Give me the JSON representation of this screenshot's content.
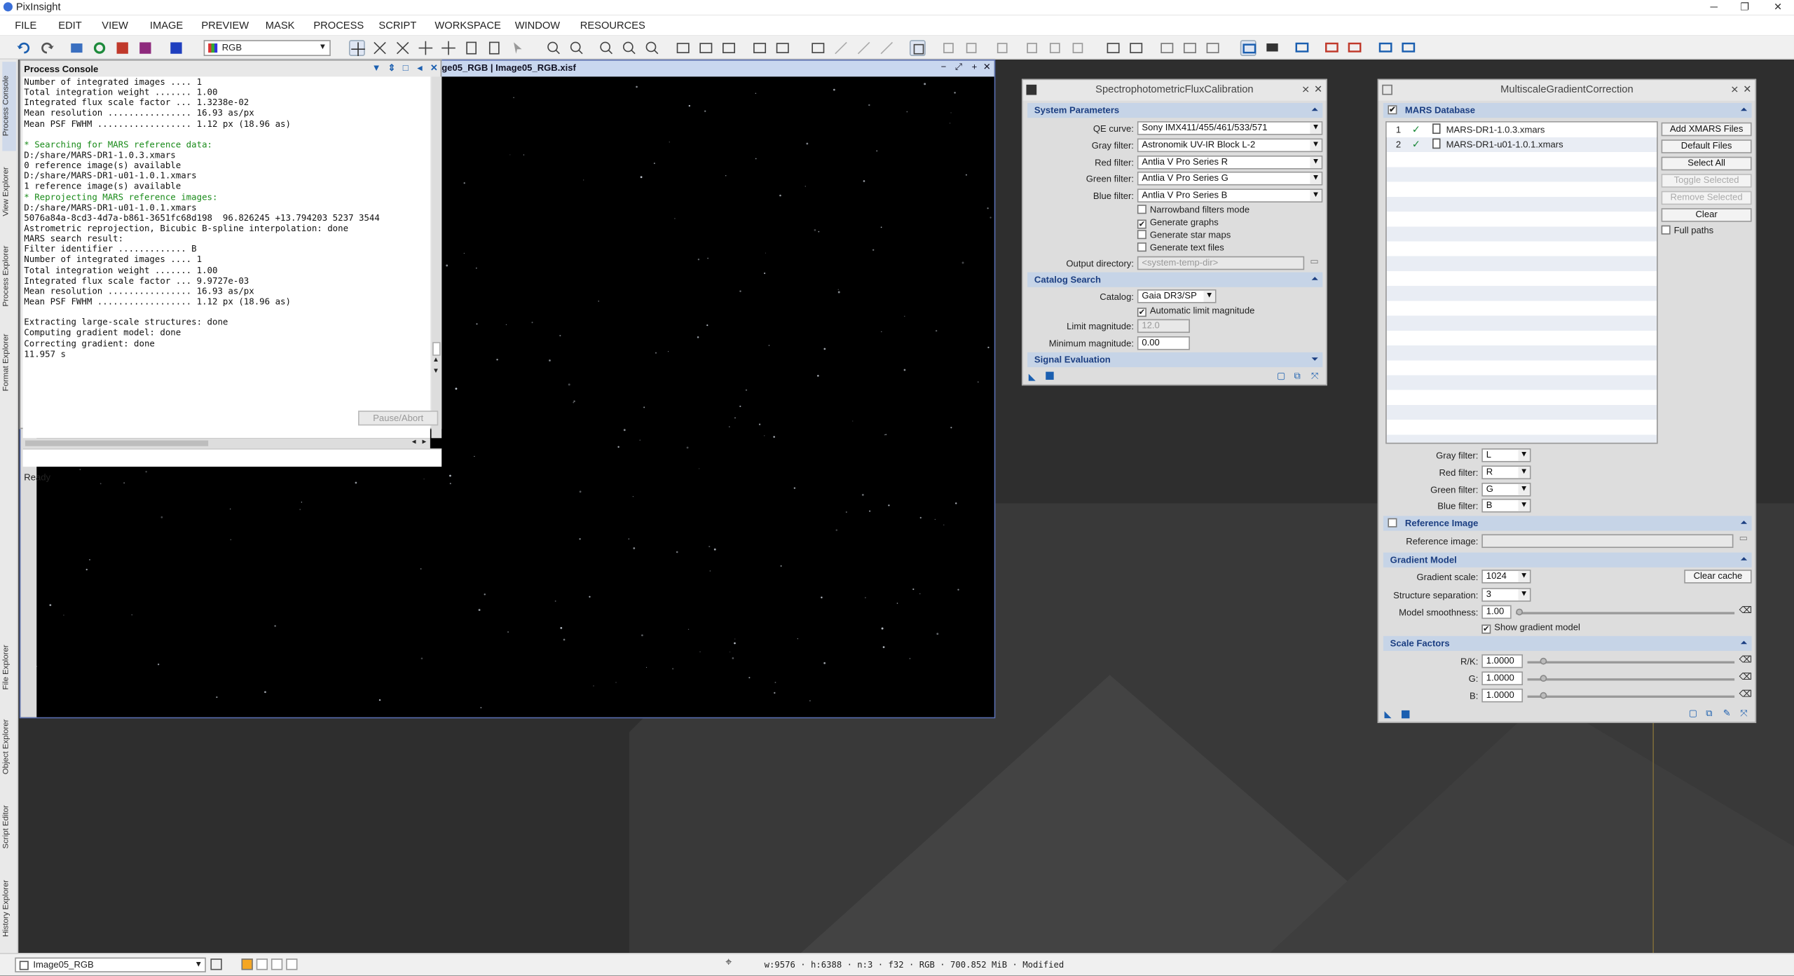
{
  "app": {
    "title": "PixInsight"
  },
  "menu": [
    "FILE",
    "EDIT",
    "VIEW",
    "IMAGE",
    "PREVIEW",
    "MASK",
    "PROCESS",
    "SCRIPT",
    "WORKSPACE",
    "WINDOW",
    "RESOURCES"
  ],
  "toolbar": {
    "view_selector": "RGB"
  },
  "left_dock": [
    "Process Console",
    "View Explorer",
    "Process Explorer",
    "Format Explorer",
    "File Explorer",
    "Object Explorer",
    "Script Editor",
    "History Explorer"
  ],
  "image_window": {
    "title": "ge05_RGB | Image05_RGB.xisf"
  },
  "console": {
    "title": "Process Console",
    "lines": [
      "Number of integrated images .... 1",
      "Total integration weight ....... 1.00",
      "Integrated flux scale factor ... 1.3238e-02",
      "Mean resolution ................ 16.93 as/px",
      "Mean PSF FWHM .................. 1.12 px (18.96 as)",
      "",
      "* Searching for MARS reference data:",
      "D:/share/MARS-DR1-1.0.3.xmars",
      "0 reference image(s) available",
      "D:/share/MARS-DR1-u01-1.0.1.xmars",
      "1 reference image(s) available",
      "* Reprojecting MARS reference images:",
      "D:/share/MARS-DR1-u01-1.0.1.xmars",
      "5076a84a-8cd3-4d7a-b861-3651fc68d198  96.826245 +13.794203 5237 3544",
      "Astrometric reprojection, Bicubic B-spline interpolation: done",
      "MARS search result:",
      "Filter identifier ............. B",
      "Number of integrated images .... 1",
      "Total integration weight ....... 1.00",
      "Integrated flux scale factor ... 9.9727e-03",
      "Mean resolution ................ 16.93 as/px",
      "Mean PSF FWHM .................. 1.12 px (18.96 as)",
      "",
      "Extracting large-scale structures: done",
      "Computing gradient model: done",
      "Correcting gradient: done",
      "11.957 s"
    ],
    "status": "Ready",
    "pause_button": "Pause/Abort"
  },
  "spfc": {
    "title": "SpectrophotometricFluxCalibration",
    "system_parameters": "System Parameters",
    "qe_curve_label": "QE curve:",
    "qe_curve": "Sony IMX411/455/461/533/571",
    "gray_filter_label": "Gray filter:",
    "gray_filter": "Astronomik UV-IR Block L-2",
    "red_filter_label": "Red filter:",
    "red_filter": "Antlia V Pro Series R",
    "green_filter_label": "Green filter:",
    "green_filter": "Antlia V Pro Series G",
    "blue_filter_label": "Blue filter:",
    "blue_filter": "Antlia V Pro Series B",
    "narrowband": "Narrowband filters mode",
    "gen_graphs": "Generate graphs",
    "gen_star_maps": "Generate star maps",
    "gen_text_files": "Generate text files",
    "output_dir_label": "Output directory:",
    "output_dir_placeholder": "<system-temp-dir>",
    "catalog_search": "Catalog Search",
    "catalog_label": "Catalog:",
    "catalog": "Gaia DR3/SP",
    "auto_limit": "Automatic limit magnitude",
    "limit_mag_label": "Limit magnitude:",
    "limit_mag": "12.0",
    "min_mag_label": "Minimum magnitude:",
    "min_mag": "0.00",
    "signal_evaluation": "Signal Evaluation"
  },
  "mgc": {
    "title": "MultiscaleGradientCorrection",
    "mars_db": "MARS Database",
    "files": [
      {
        "n": "1",
        "name": "MARS-DR1-1.0.3.xmars"
      },
      {
        "n": "2",
        "name": "MARS-DR1-u01-1.0.1.xmars"
      }
    ],
    "btn_add": "Add XMARS Files",
    "btn_default": "Default Files",
    "btn_select_all": "Select All",
    "btn_toggle": "Toggle Selected",
    "btn_remove": "Remove Selected",
    "btn_clear": "Clear",
    "full_paths": "Full paths",
    "gray_filter_label": "Gray filter:",
    "gray_filter": "L",
    "red_filter_label": "Red filter:",
    "red_filter": "R",
    "green_filter_label": "Green filter:",
    "green_filter": "G",
    "blue_filter_label": "Blue filter:",
    "blue_filter": "B",
    "reference_image_section": "Reference Image",
    "reference_image_label": "Reference image:",
    "gradient_model": "Gradient Model",
    "gradient_scale_label": "Gradient scale:",
    "gradient_scale": "1024",
    "clear_cache": "Clear cache",
    "structure_sep_label": "Structure separation:",
    "structure_sep": "3",
    "smoothness_label": "Model smoothness:",
    "smoothness": "1.00",
    "show_model": "Show gradient model",
    "scale_factors": "Scale Factors",
    "rk_label": "R/K:",
    "rk": "1.0000",
    "g_label": "G:",
    "g": "1.0000",
    "b_label": "B:",
    "b": "1.0000"
  },
  "bottom": {
    "view": "Image05_RGB",
    "info": "w:9576 · h:6388 · n:3 · f32 · RGB · 700.852 MiB · Modified"
  }
}
